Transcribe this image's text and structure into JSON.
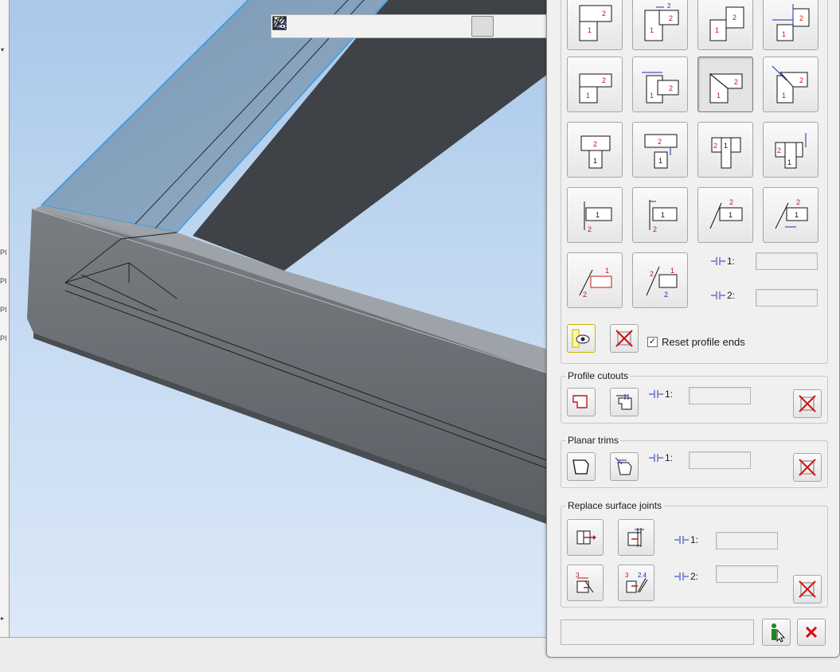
{
  "window": {
    "strip_marks": [
      "PI",
      "PI",
      "PI",
      "PI"
    ]
  },
  "toolbar": {
    "items": [
      {
        "name": "zoom-window-icon"
      },
      {
        "name": "zoom-in-icon"
      },
      {
        "name": "zoom-out-icon"
      },
      {
        "name": "zoom-fit-icon"
      },
      {
        "name": "view-cube-icon"
      },
      {
        "name": "view-direction-icon"
      },
      {
        "name": "properties-icon"
      },
      {
        "name": "snap-icon"
      },
      {
        "name": "section-plane-icon",
        "active": true
      },
      {
        "name": "show-hide-icon"
      },
      {
        "name": "visibility-filter-icon"
      }
    ]
  },
  "panel": {
    "joint_types": [
      {
        "name": "joint-1-butt-top"
      },
      {
        "name": "joint-2-butt-top-gap"
      },
      {
        "name": "joint-3-butt-side"
      },
      {
        "name": "joint-4-butt-side-gap"
      },
      {
        "name": "joint-5-butt-offset"
      },
      {
        "name": "joint-6-butt-offset-gap"
      },
      {
        "name": "joint-7-miter",
        "pressed": true
      },
      {
        "name": "joint-8-miter-gap"
      },
      {
        "name": "joint-9-t-joint"
      },
      {
        "name": "joint-10-t-joint-gap"
      },
      {
        "name": "joint-11-t-joint-side"
      },
      {
        "name": "joint-12-t-joint-side-gap"
      },
      {
        "name": "joint-13-end-plate"
      },
      {
        "name": "joint-14-end-plate-gap"
      },
      {
        "name": "joint-15-angled"
      },
      {
        "name": "joint-16-angled-gap"
      },
      {
        "name": "joint-17-angled-cut"
      },
      {
        "name": "joint-18-angled-cut-gap"
      }
    ],
    "gap1_label": "1:",
    "gap2_label": "2:",
    "gap1_value": "",
    "gap2_value": "",
    "reset_profile_ends": {
      "label": "Reset profile ends",
      "checked": "✓"
    },
    "profile_cutouts": {
      "title": "Profile cutouts",
      "gap_label": "1:",
      "gap_value": ""
    },
    "planar_trims": {
      "title": "Planar trims",
      "gap_label": "1:",
      "gap_value": ""
    },
    "replace_surface_joints": {
      "title": "Replace surface joints",
      "gap1_label": "1:",
      "gap2_label": "2:",
      "gap1_value": "",
      "gap2_value": ""
    },
    "message": ""
  },
  "colors": {
    "sky_top": "#a9c8ea",
    "profile_top": "#7f99b3",
    "profile_side": "#6a6e73",
    "profile_dark": "#3f4246",
    "selection_edge": "#3aa0e0",
    "dim_blue": "#1b2fb0",
    "dim_red": "#c01818",
    "cancel_red": "#d01010",
    "ok_green": "#1a8a1a"
  }
}
